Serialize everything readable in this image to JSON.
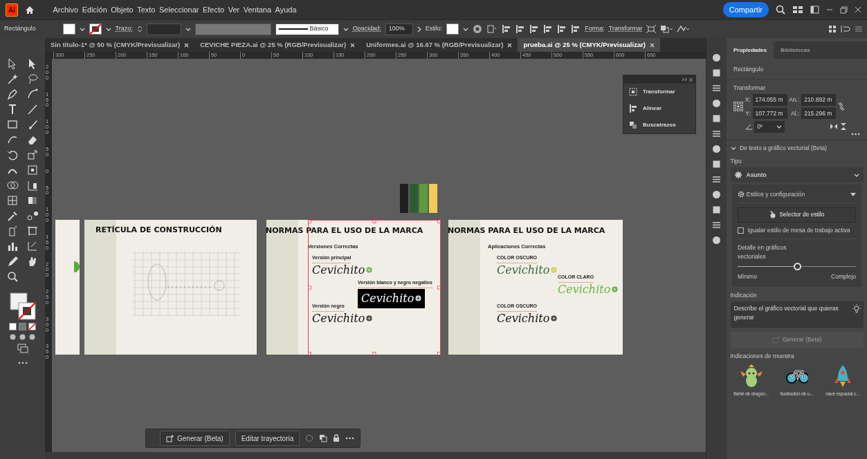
{
  "app_bar": {
    "logo": "Ai",
    "menus": [
      "Archivo",
      "Edición",
      "Objeto",
      "Texto",
      "Seleccionar",
      "Efecto",
      "Ver",
      "Ventana",
      "Ayuda"
    ],
    "share_button": "Compartir"
  },
  "control_bar": {
    "object_type": "Rectángulo",
    "stroke_label": "Trazo:",
    "brush": "Básico",
    "opacity_label": "Opacidad:",
    "opacity": "100%",
    "style_label": "Estilo:",
    "shape_label": "Forma:",
    "transform_label": "Transformar"
  },
  "document_tabs": [
    {
      "label": "Sin título-1* @ 50 % (CMYK/Previsualizar)",
      "selected": false
    },
    {
      "label": "CEVICHE PIEZA.ai @ 25 % (RGB/Previsualizar)",
      "selected": false
    },
    {
      "label": "Uniformes.ai @ 16.67 % (RGB/Previsualizar)",
      "selected": false
    },
    {
      "label": "prueba.ai @ 25 % (CMYK/Previsualizar)",
      "selected": true
    }
  ],
  "top_ruler": [
    "300",
    "250",
    "200",
    "150",
    "100",
    "50",
    "0",
    "50",
    "100",
    "150",
    "200",
    "250",
    "300",
    "350",
    "400",
    "450",
    "500",
    "550",
    "600",
    "650"
  ],
  "left_ruler": [
    "200",
    "150",
    "100",
    "50",
    "0",
    "50",
    "100",
    "150",
    "200",
    "250",
    "300",
    "350"
  ],
  "floating_panel": {
    "items": [
      {
        "label": "Transformar"
      },
      {
        "label": "Alinear"
      },
      {
        "label": "Buscatrazos"
      }
    ]
  },
  "swatches": [
    {
      "color": "#1f1f1f"
    },
    {
      "color": "#2e5b35"
    },
    {
      "color": "#5c9c3e"
    },
    {
      "color": "#f0cb58"
    }
  ],
  "artboards": [
    {
      "kind": "partial"
    },
    {
      "kind": "grid",
      "title": "RETÍCULA DE CONSTRUCCIÓN"
    },
    {
      "kind": "versions",
      "title": "NORMAS PARA EL USO DE LA MARCA",
      "subtitle": "Versiones Correctas",
      "selected": true,
      "logos": [
        {
          "label": "Versión principal",
          "text": "Cevichito"
        },
        {
          "label": "Versión blanco y negro negativo",
          "text": "Cevichito"
        },
        {
          "label": "Versión negro",
          "text": "Cevichito"
        }
      ]
    },
    {
      "kind": "applications",
      "title": "NORMAS PARA EL USO DE LA MARCA",
      "subtitle": "Aplicaciones Correctas",
      "selected": false,
      "logos": [
        {
          "label": "COLOR OSCURO",
          "text": "Cevichito"
        },
        {
          "label": "COLOR CLARO",
          "text": "Cevichito"
        },
        {
          "label": "COLOR OSCURO",
          "text": "Cevichito"
        }
      ]
    }
  ],
  "context_toolbar": {
    "generate_button": "Generar (Beta)",
    "edit_path_button": "Editar trayectoria"
  },
  "properties_panel": {
    "tabs": [
      {
        "label": "Propiedades",
        "selected": true
      },
      {
        "label": "Bibliotecas",
        "selected": false
      }
    ],
    "object_type": "Rectángulo",
    "transform_title": "Transformar",
    "fields": [
      {
        "label": "X:",
        "value": "174.055 m"
      },
      {
        "label": "An.:",
        "value": "210.892 m"
      },
      {
        "label": "Y:",
        "value": "107.772 m"
      },
      {
        "label": "Al.:",
        "value": "215.296 m"
      }
    ],
    "angle": "0º",
    "text_to_vector": {
      "title": "De texto a gráfico vectorial (Beta)",
      "type_label": "Tipo",
      "type_value": "Asunto",
      "styles_title": "Estilos y configuración",
      "style_picker_button": "Selector de estilo",
      "match_style": {
        "label": "Igualar estilo de mesa de trabajo activa",
        "checked": false
      },
      "detail_label": "Detalle en gráficos vectoriales",
      "detail": {
        "level": 0.5,
        "min_label": "Mínimo",
        "max_label": "Complejo"
      },
      "prompt_label": "Indicación",
      "prompt_placeholder": "Describe el gráfico vectorial que quieras generar",
      "generate_button": {
        "label": "Generar (Beta)",
        "disabled": true
      },
      "samples_label": "Indicaciones de muestra",
      "samples": [
        {
          "kind": "dragon",
          "caption": "Bebé de dragón..."
        },
        {
          "kind": "bicycle",
          "caption": "Ilustración de u..."
        },
        {
          "kind": "rocket",
          "caption": "nave espacial c..."
        }
      ]
    }
  }
}
